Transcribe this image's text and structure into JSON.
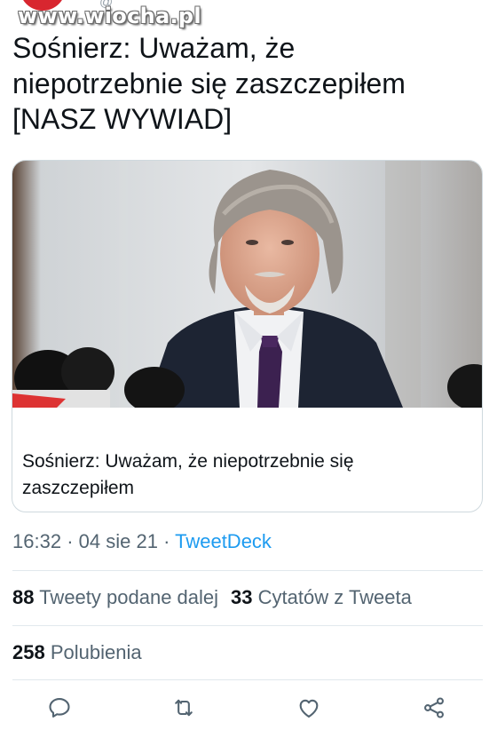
{
  "watermark": "www.wiocha.pl",
  "tweet": {
    "text_lines": [
      "Sośnierz: Uważam, że",
      "niepotrzebnie się zaszczepiłem",
      "[NASZ WYWIAD]"
    ]
  },
  "card": {
    "title_lines": [
      "Sośnierz: Uważam, że niepotrzebnie się",
      "zaszczepiłem"
    ]
  },
  "meta": {
    "time": "16:32",
    "separator": "·",
    "date": "04 sie 21",
    "source": "TweetDeck"
  },
  "stats": {
    "retweets_count": "88",
    "retweets_label": "Tweety podane dalej",
    "quotes_count": "33",
    "quotes_label": "Cytatów z Tweeta",
    "likes_count": "258",
    "likes_label": "Polubienia"
  },
  "actions": {
    "icons": [
      "reply-icon",
      "retweet-icon",
      "like-icon",
      "share-icon"
    ]
  },
  "colors": {
    "text": "#0f1419",
    "secondary": "#536471",
    "link": "#1d9bf0",
    "border": "#cfd9de",
    "divider": "#e1e8ed"
  }
}
